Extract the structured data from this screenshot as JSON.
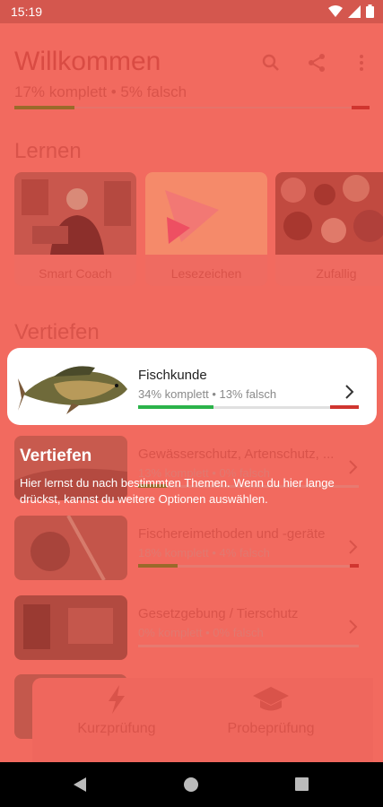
{
  "status_bar": {
    "time": "15:19"
  },
  "header": {
    "title": "Willkommen",
    "subtitle": "17% komplett • 5% falsch",
    "progress_complete": 0.17,
    "progress_wrong": 0.05
  },
  "learn": {
    "heading": "Lernen",
    "cards": [
      {
        "label": "Smart Coach"
      },
      {
        "label": "Lesezeichen"
      },
      {
        "label": "Zufallig"
      }
    ]
  },
  "deepen": {
    "heading": "Vertiefen",
    "topics": [
      {
        "name": "Fischkunde",
        "stats": "34% komplett • 13% falsch",
        "complete": 0.34,
        "wrong": 0.13
      },
      {
        "name": "Gewässerschutz, Artenschutz, ...",
        "stats": "13% komplett • 0% falsch",
        "complete": 0.13,
        "wrong": 0.0
      },
      {
        "name": "Fischereimethoden und -geräte",
        "stats": "18% komplett • 4% falsch",
        "complete": 0.18,
        "wrong": 0.04
      },
      {
        "name": "Gesetzgebung / Tierschutz",
        "stats": "0% komplett • 0% falsch",
        "complete": 0.0,
        "wrong": 0.0
      }
    ]
  },
  "tooltip": {
    "title": "Vertiefen",
    "text": "Hier lernst du nach bestimmten Themen. Wenn du hier lange drückst, kannst du weitere Optionen auswählen."
  },
  "bottom_bar": {
    "items": [
      {
        "label": "Kurzprüfung",
        "icon": "lightning-icon"
      },
      {
        "label": "Probeprüfung",
        "icon": "graduation-cap-icon"
      }
    ]
  },
  "colors": {
    "overlay": "#f26a5f",
    "accent_green": "#2bb34a",
    "accent_red": "#d0352f"
  }
}
